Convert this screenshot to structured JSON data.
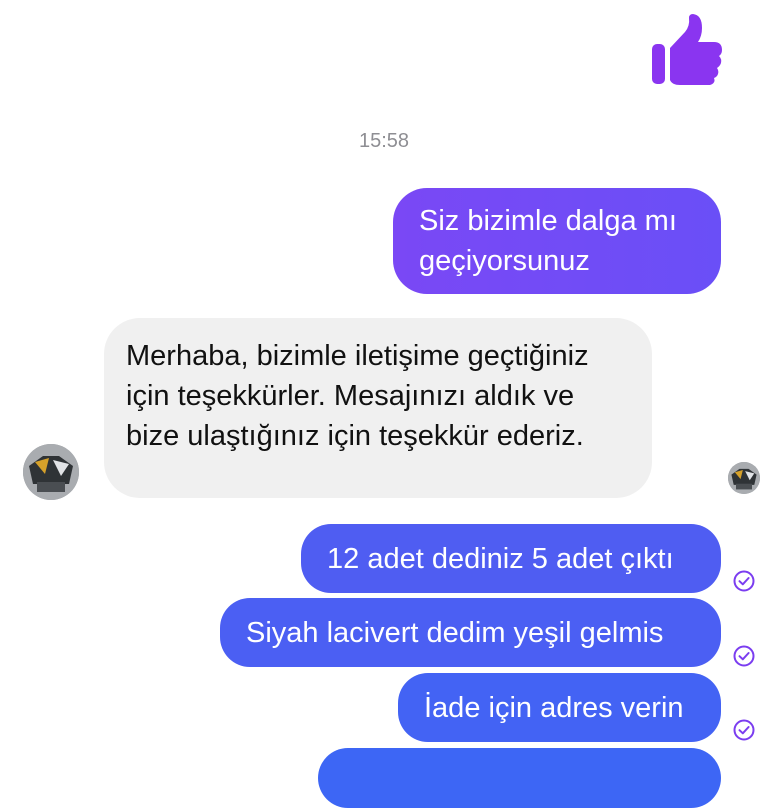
{
  "chat": {
    "timestamp": "15:58",
    "messages": [
      {
        "direction": "outgoing",
        "text": "Siz bizimle dalga mı geçiyorsunuz"
      },
      {
        "direction": "incoming",
        "text": "Merhaba, bizimle iletişime geçtiğiniz için teşekkürler. Mesajınızı aldık ve bize ulaştığınız için teşekkür ederiz."
      },
      {
        "direction": "outgoing",
        "text": "12 adet dediniz 5 adet çıktı",
        "status": "sent-check-icon"
      },
      {
        "direction": "outgoing",
        "text": "Siyah lacivert dedim yeşil gelmis",
        "status": "sent-check-icon"
      },
      {
        "direction": "outgoing",
        "text": "İade için adres verin",
        "status": "sent-check-icon"
      },
      {
        "direction": "outgoing",
        "text": ""
      }
    ]
  },
  "icons": {
    "like": "thumbs-up-icon",
    "sent": "sent-check-icon",
    "avatar": "contact-avatar"
  },
  "colors": {
    "outgoing_top": "#7048f5",
    "outgoing_bottom": "#3d66f5",
    "incoming_bg": "#f0f0f0",
    "accent": "#7b3df0"
  }
}
